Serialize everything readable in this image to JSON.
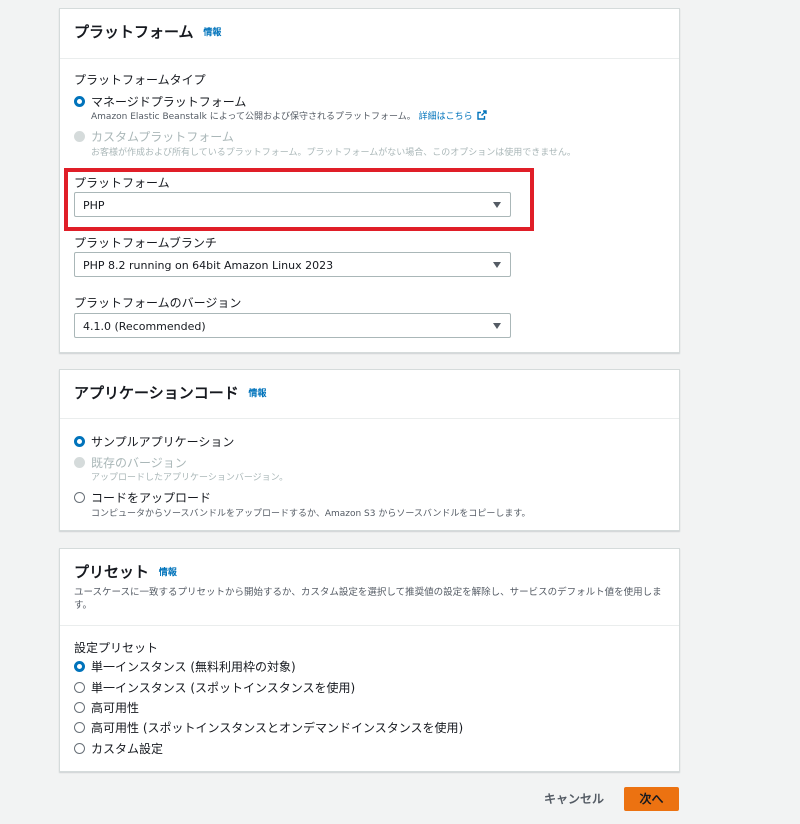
{
  "platform_panel": {
    "title": "プラットフォーム",
    "info": "情報",
    "type_label": "プラットフォームタイプ",
    "managed": {
      "label": "マネージドプラットフォーム",
      "desc": "Amazon Elastic Beanstalk によって公開および保守されるプラットフォーム。",
      "link": "詳細はこちら"
    },
    "custom": {
      "label": "カスタムプラットフォーム",
      "desc": "お客様が作成および所有しているプラットフォーム。プラットフォームがない場合、このオプションは使用できません。"
    },
    "platform_label": "プラットフォーム",
    "platform_value": "PHP",
    "branch_label": "プラットフォームブランチ",
    "branch_value": "PHP 8.2 running on 64bit Amazon Linux 2023",
    "version_label": "プラットフォームのバージョン",
    "version_value": "4.1.0 (Recommended)"
  },
  "appcode_panel": {
    "title": "アプリケーションコード",
    "info": "情報",
    "sample": {
      "label": "サンプルアプリケーション"
    },
    "existing": {
      "label": "既存のバージョン",
      "desc": "アップロードしたアプリケーションバージョン。"
    },
    "upload": {
      "label": "コードをアップロード",
      "desc": "コンピュータからソースバンドルをアップロードするか、Amazon S3 からソースバンドルをコピーします。"
    }
  },
  "preset_panel": {
    "title": "プリセット",
    "info": "情報",
    "desc": "ユースケースに一致するプリセットから開始するか、カスタム設定を選択して推奨値の設定を解除し、サービスのデフォルト値を使用しま す。",
    "config_label": "設定プリセット",
    "options": [
      "単一インスタンス (無料利用枠の対象)",
      "単一インスタンス (スポットインスタンスを使用)",
      "高可用性",
      "高可用性 (スポットインスタンスとオンデマンドインスタンスを使用)",
      "カスタム設定"
    ]
  },
  "footer": {
    "cancel": "キャンセル",
    "next": "次へ"
  },
  "colors": {
    "accent": "#0073bb",
    "primary_button": "#ec7211",
    "highlight": "#e01e28"
  },
  "icons": {
    "external_link": "external-link-icon",
    "caret": "caret-down-icon"
  }
}
